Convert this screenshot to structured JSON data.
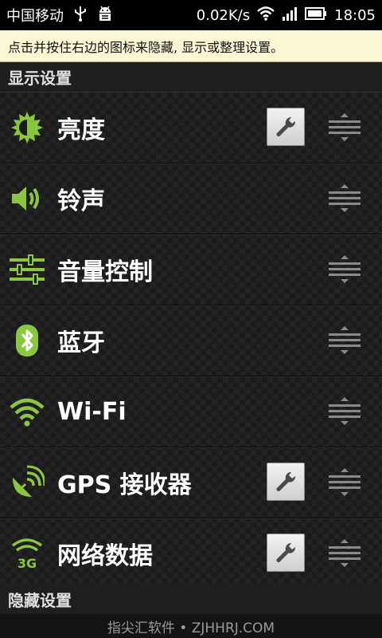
{
  "status_bar": {
    "carrier": "中国移动",
    "speed": "0.02K/s",
    "time": "18:05",
    "icons": [
      "usb-icon",
      "android-debug-icon",
      "wifi-icon",
      "signal-icon",
      "battery-icon"
    ]
  },
  "hint": "点击并按住右边的图标来隐藏, 显示或整理设置。",
  "sections": {
    "shown": "显示设置",
    "hidden": "隐藏设置"
  },
  "items": [
    {
      "label": "亮度",
      "icon": "brightness-icon",
      "has_settings": true
    },
    {
      "label": "铃声",
      "icon": "speaker-icon",
      "has_settings": false
    },
    {
      "label": "音量控制",
      "icon": "volume-sliders-icon",
      "has_settings": false
    },
    {
      "label": "蓝牙",
      "icon": "bluetooth-icon",
      "has_settings": false
    },
    {
      "label": "Wi-Fi",
      "icon": "wifi-icon",
      "has_settings": false
    },
    {
      "label": "GPS 接收器",
      "icon": "gps-satellite-icon",
      "has_settings": true
    },
    {
      "label": "网络数据",
      "icon": "3g-data-icon",
      "has_settings": true
    }
  ],
  "watermark": "指尖汇软件 • ZJHHRJ.COM",
  "colors": {
    "accent_green": "#8cc63f",
    "hint_bg": "#fbf6d4",
    "background": "#1b1b1b"
  }
}
